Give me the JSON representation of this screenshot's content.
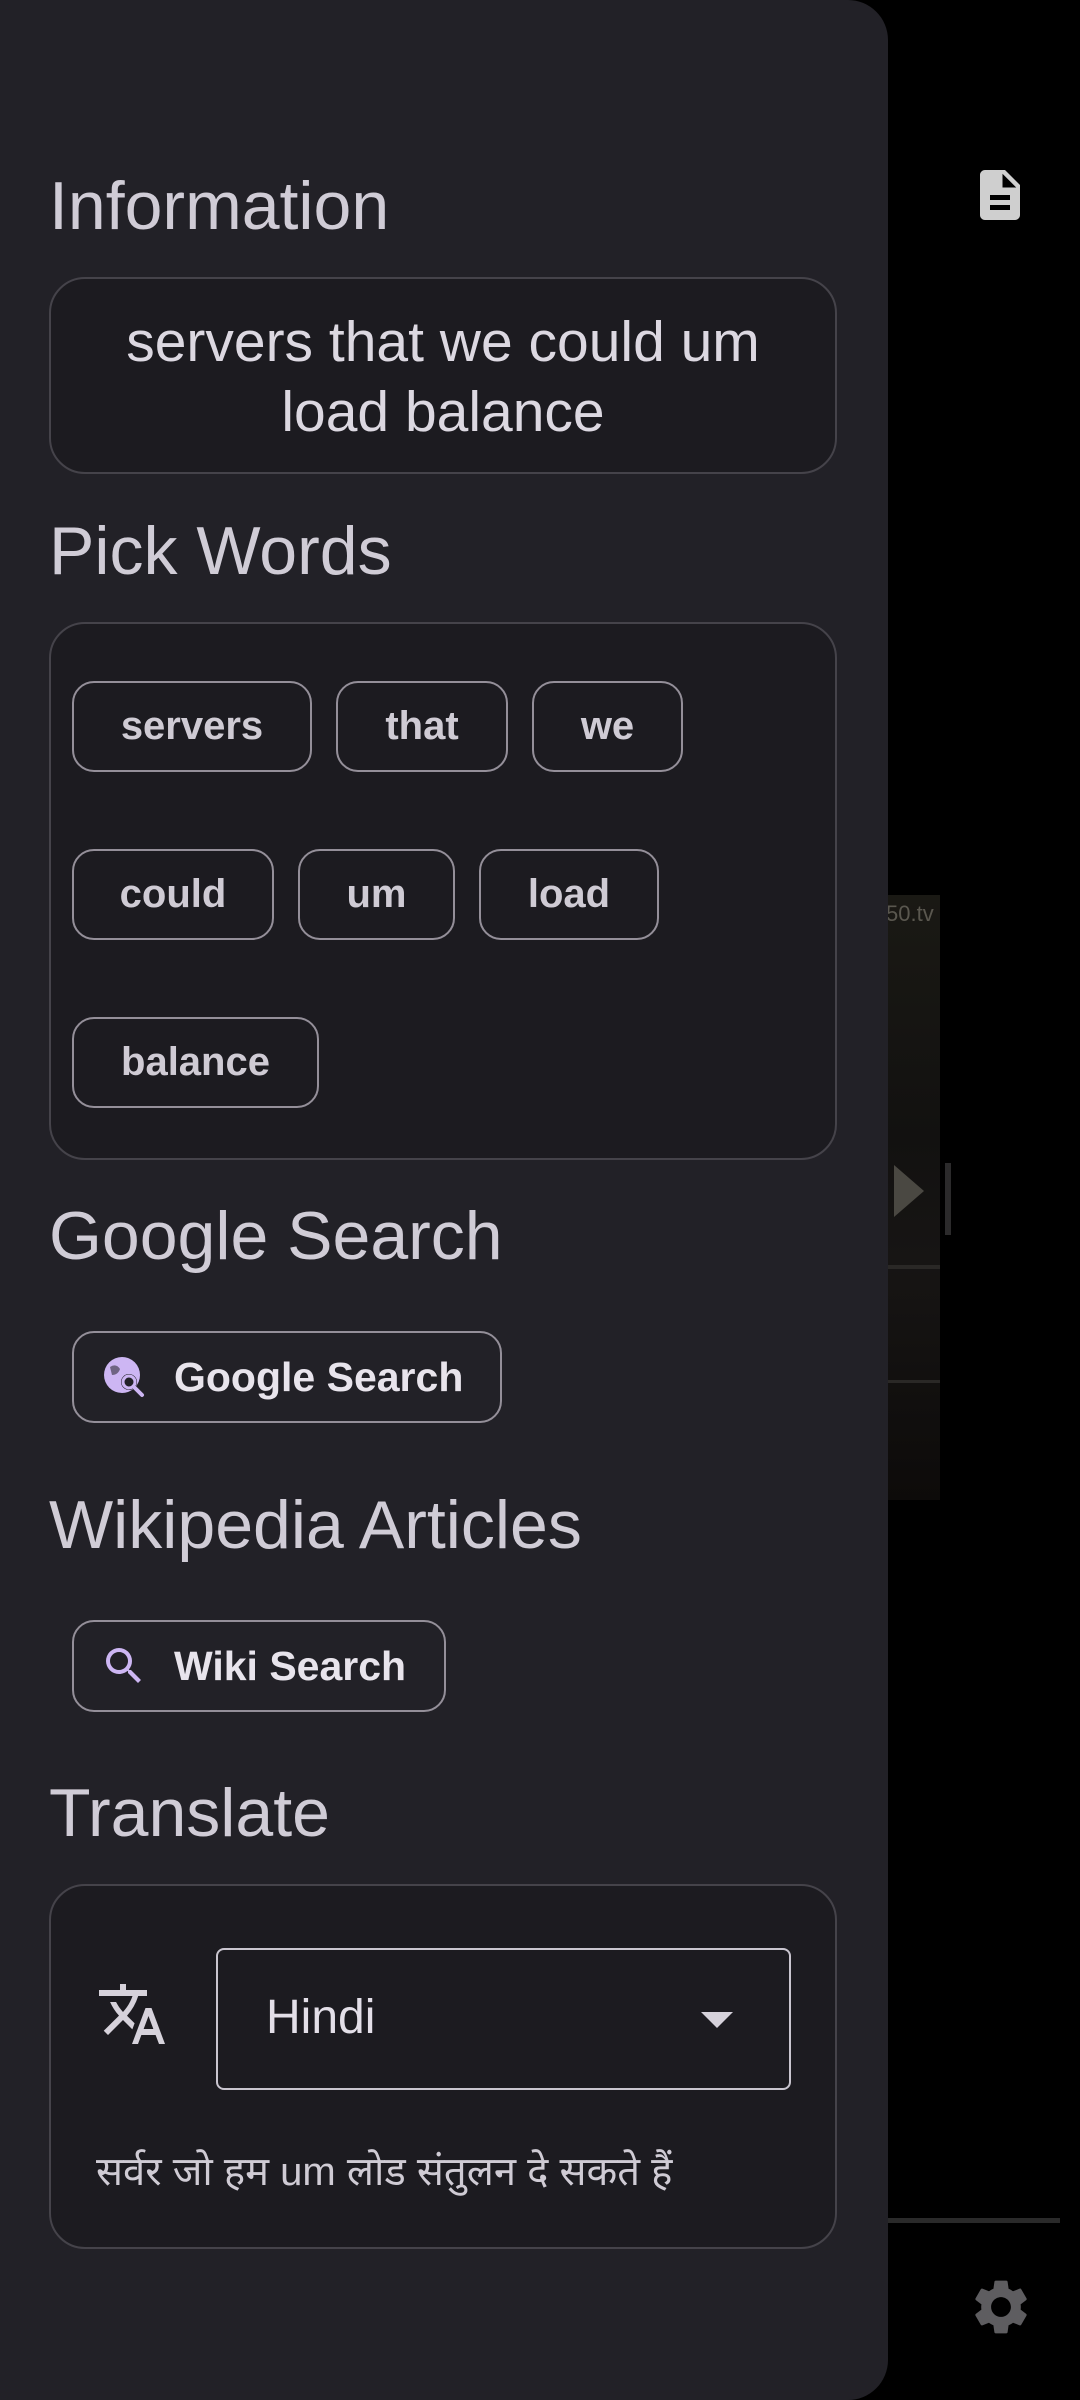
{
  "background": {
    "video_watermark": "50.tv"
  },
  "sections": {
    "information": {
      "title": "Information",
      "text": "servers that we could um load balance"
    },
    "pick_words": {
      "title": "Pick Words",
      "words": [
        "servers",
        "that",
        "we",
        "could",
        "um",
        "load",
        "balance"
      ]
    },
    "google": {
      "title": "Google Search",
      "button_label": "Google Search"
    },
    "wikipedia": {
      "title": "Wikipedia Articles",
      "button_label": "Wiki Search"
    },
    "translate": {
      "title": "Translate",
      "language": "Hindi",
      "translated_text": "सर्वर जो हम um लोड संतुलन दे सकते हैं"
    }
  },
  "icons": {
    "document": "document-icon",
    "settings": "gear-icon",
    "google": "travel-explore-icon",
    "wiki": "search-icon",
    "translate": "translate-icon",
    "dropdown": "dropdown-arrow-icon"
  },
  "colors": {
    "drawer_bg": "#222127",
    "box_bg": "#1c1b20",
    "accent": "#cdb6f3"
  }
}
